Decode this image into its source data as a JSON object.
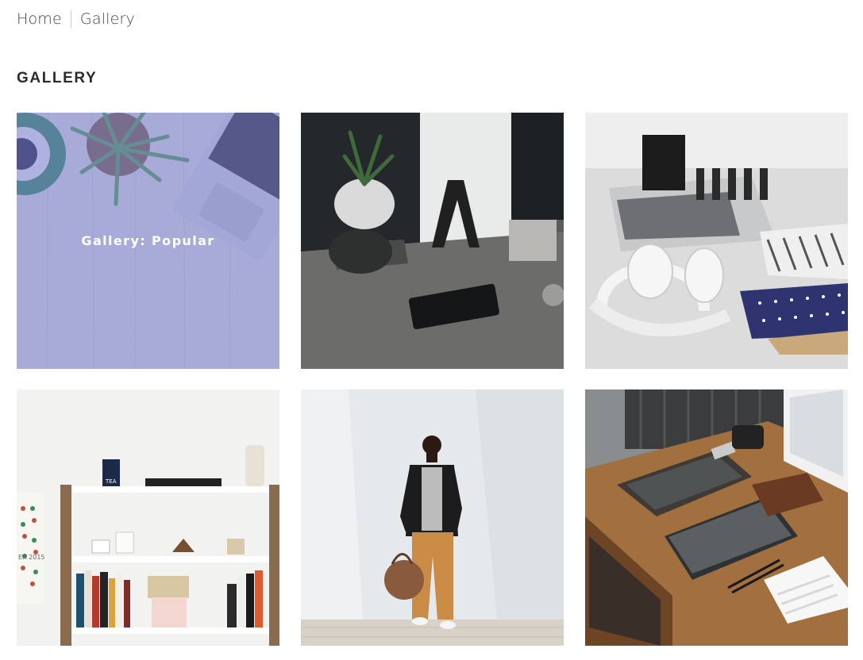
{
  "breadcrumb": {
    "home_label": "Home",
    "current_label": "Gallery"
  },
  "page": {
    "title": "GALLERY"
  },
  "gallery": {
    "items": [
      {
        "image": "desk-plant-laptop-photo",
        "caption": "Gallery: Popular",
        "hovered": true
      },
      {
        "image": "letters-phone-desk-photo"
      },
      {
        "image": "headphones-notebooks-photo"
      },
      {
        "image": "white-bookshelf-photo",
        "book_label": "TEA",
        "calendar_label": "ER 2015"
      },
      {
        "image": "man-with-bag-photo"
      },
      {
        "image": "wooden-desk-clipboard-photo"
      }
    ]
  },
  "colors": {
    "overlay": "#7a7fd2",
    "text": "#333333",
    "separator": "#cccccc"
  }
}
